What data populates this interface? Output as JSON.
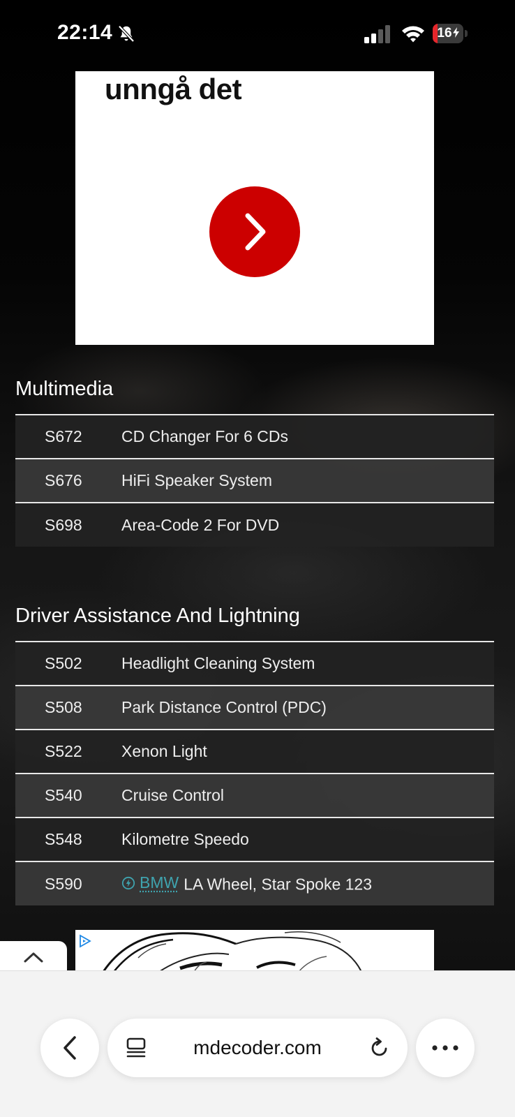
{
  "status_bar": {
    "time": "22:14",
    "battery_percent": "16",
    "battery_level": 0.16,
    "icons": [
      "bell-slash-icon",
      "cellular-signal-icon",
      "wifi-icon",
      "battery-charging-icon"
    ]
  },
  "ad_top": {
    "headline": "unngå det",
    "button_icon": "chevron-right-icon",
    "button_color": "#cc0000"
  },
  "sections": [
    {
      "title": "Multimedia",
      "rows": [
        {
          "code": "S672",
          "label": "CD Changer For 6 CDs"
        },
        {
          "code": "S676",
          "label": "HiFi Speaker System"
        },
        {
          "code": "S698",
          "label": "Area-Code 2 For DVD"
        }
      ]
    },
    {
      "title": "Driver Assistance And Lightning",
      "rows": [
        {
          "code": "S502",
          "label": "Headlight Cleaning System"
        },
        {
          "code": "S508",
          "label": "Park Distance Control (PDC)"
        },
        {
          "code": "S522",
          "label": "Xenon Light"
        },
        {
          "code": "S540",
          "label": "Cruise Control"
        },
        {
          "code": "S548",
          "label": "Kilometre Speedo"
        },
        {
          "code": "S590",
          "link_text": "BMW",
          "label": "LA Wheel, Star Spoke 123"
        }
      ]
    }
  ],
  "scroll_top": {
    "icon": "chevron-up-icon"
  },
  "browser": {
    "url": "mdecoder.com",
    "icons": [
      "back-chevron-icon",
      "tabs-icon",
      "reload-icon",
      "more-dots-icon"
    ]
  },
  "colors": {
    "ad_red": "#cc0000",
    "link": "#3fa3ae",
    "battery_low": "#e5262b"
  }
}
